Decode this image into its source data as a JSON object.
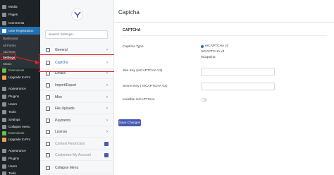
{
  "wp_sidebar": {
    "top_items": [
      {
        "label": "Media",
        "icon": "media-icon"
      },
      {
        "label": "Pages",
        "icon": "pages-icon"
      },
      {
        "label": "Comments",
        "icon": "comments-icon"
      },
      {
        "label": "User Registration",
        "icon": "user-registration-icon"
      }
    ],
    "ur_submenu": [
      "Dashboard",
      "All Forms",
      "Add New",
      "Settings",
      "Status"
    ],
    "ur_submenu_current": "Settings",
    "ur_extra": [
      {
        "label": "Extensions",
        "icon": "extensions-icon",
        "style": "green"
      },
      {
        "label": "Upgrade to Pro",
        "icon": "upgrade-icon",
        "style": "orange"
      }
    ],
    "middle_items": [
      {
        "label": "Appearance",
        "icon": "appearance-icon"
      },
      {
        "label": "Plugins",
        "icon": "plugins-icon"
      },
      {
        "label": "Users",
        "icon": "users-icon"
      },
      {
        "label": "Tools",
        "icon": "tools-icon"
      },
      {
        "label": "Settings",
        "icon": "settings-icon"
      },
      {
        "label": "Collapse menu",
        "icon": "collapse-icon"
      },
      {
        "label": "Extensions",
        "icon": "extensions-icon",
        "style": "green"
      },
      {
        "label": "Upgrade to Pro",
        "icon": "upgrade-icon",
        "style": "orange"
      }
    ],
    "bottom_items": [
      {
        "label": "Appearance",
        "icon": "appearance-icon"
      },
      {
        "label": "Plugins",
        "icon": "plugins-icon"
      },
      {
        "label": "Users",
        "icon": "users-icon"
      },
      {
        "label": "Tools",
        "icon": "tools-icon"
      }
    ]
  },
  "settings_nav": {
    "search_placeholder": "Search Settings...",
    "items": [
      {
        "label": "General",
        "icon": "general-icon"
      },
      {
        "label": "Captcha",
        "icon": "captcha-icon",
        "active": true
      },
      {
        "label": "Emails",
        "icon": "emails-icon"
      },
      {
        "label": "Import/Export",
        "icon": "import-export-icon"
      },
      {
        "label": "Misc",
        "icon": "misc-icon"
      },
      {
        "label": "File Uploads",
        "icon": "file-uploads-icon"
      },
      {
        "label": "Payments",
        "icon": "payments-icon"
      },
      {
        "label": "License",
        "icon": "license-icon"
      },
      {
        "label": "Content Restriction",
        "icon": "content-restriction-icon",
        "locked": true
      },
      {
        "label": "Customize My Account",
        "icon": "customize-account-icon",
        "locked": true
      },
      {
        "label": "Collapse Menu",
        "icon": "collapse-menu-icon"
      }
    ]
  },
  "main": {
    "title": "Captcha",
    "section_title": "CAPTCHA",
    "captcha_type_label": "Captcha Type",
    "captcha_options": [
      "reCAPTCHA v2",
      "reCAPTCHA v3",
      "hCaptcha"
    ],
    "captcha_selected": "reCAPTCHA v2",
    "site_key_label": "Site Key (reCAPTCHA V2)",
    "site_key_value": "",
    "secret_key_label": "Secret Key ( reCAPTCHA V2)",
    "secret_key_value": "",
    "invisible_label": "Invisible reCAPTCHA",
    "invisible_on": false,
    "save_label": "Save Changes"
  },
  "colors": {
    "wp_sidebar_bg": "#1d2327",
    "active_menu": "#2271b1",
    "primary_button": "#475bb2",
    "highlight_red": "#e02424"
  }
}
